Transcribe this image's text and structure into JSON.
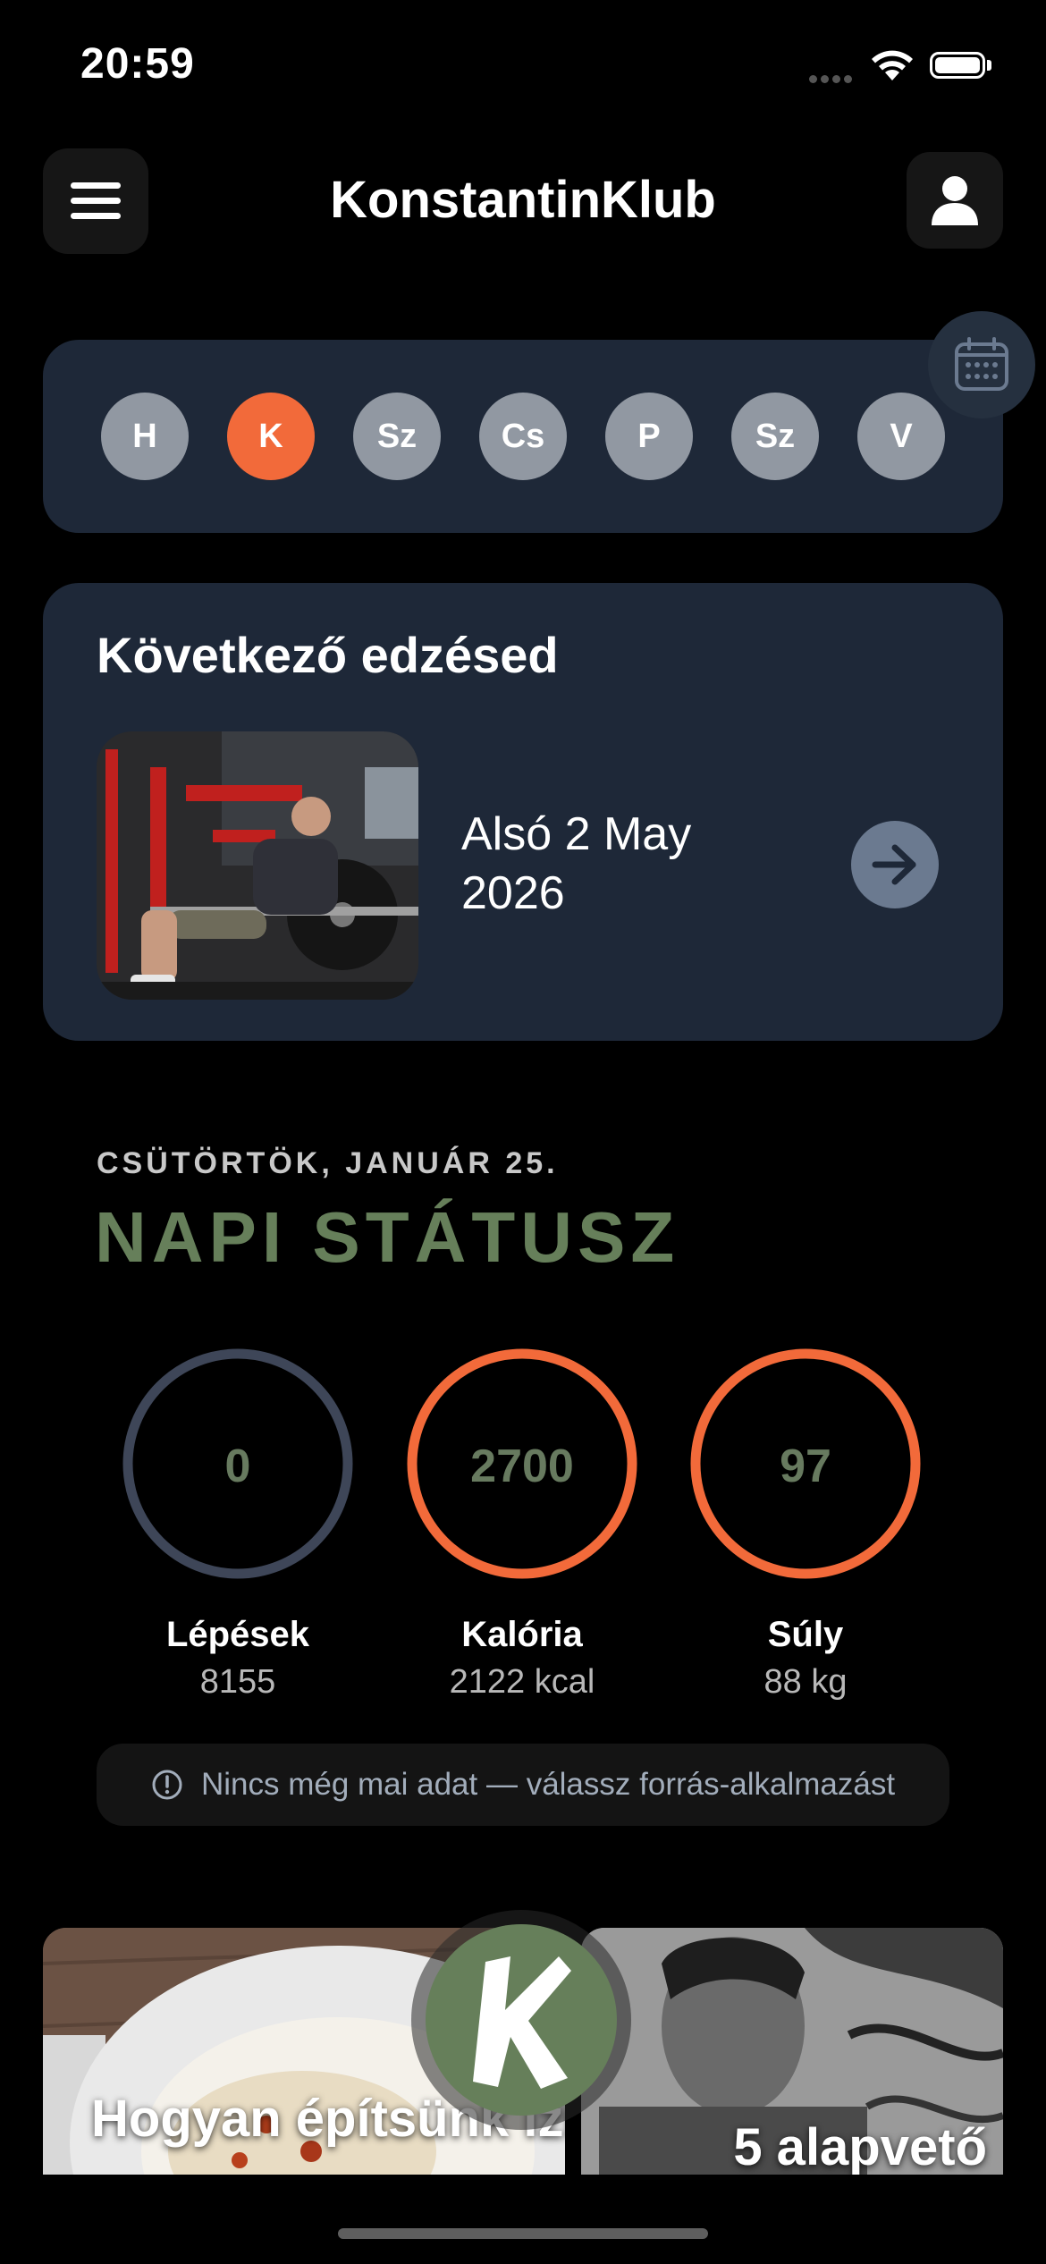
{
  "status_bar": {
    "time": "20:59"
  },
  "header": {
    "title": "KonstantinKlub"
  },
  "days": [
    "H",
    "K",
    "Sz",
    "Cs",
    "P",
    "Sz",
    "V"
  ],
  "next_workout": {
    "heading": "Következő edzésed",
    "name": "Alsó 2 May 2026"
  },
  "daily_status": {
    "date_label": "CSÜTÖRTÖK, JANUÁR 25.",
    "title": "NAPI STÁTUSZ",
    "metrics": [
      {
        "value": "0",
        "label": "Lépések",
        "sub": "8155",
        "ring_color": "#3e4658",
        "progress": 0
      },
      {
        "value": "2700",
        "label": "Kalória",
        "sub": "2122 kcal",
        "ring_color": "#f26a3a",
        "progress": 1
      },
      {
        "value": "97",
        "label": "Súly",
        "sub": "88 kg",
        "ring_color": "#f26a3a",
        "progress": 1
      }
    ],
    "info": "Nincs még mai adat — válassz forrás-alkalmazást"
  },
  "articles": [
    {
      "title": "Hogyan építsünk izmot"
    },
    {
      "title": "5 alapvető"
    }
  ],
  "colors": {
    "accent": "#f26a3a",
    "brand_green": "#667f5a",
    "card_bg": "#1e2838"
  }
}
